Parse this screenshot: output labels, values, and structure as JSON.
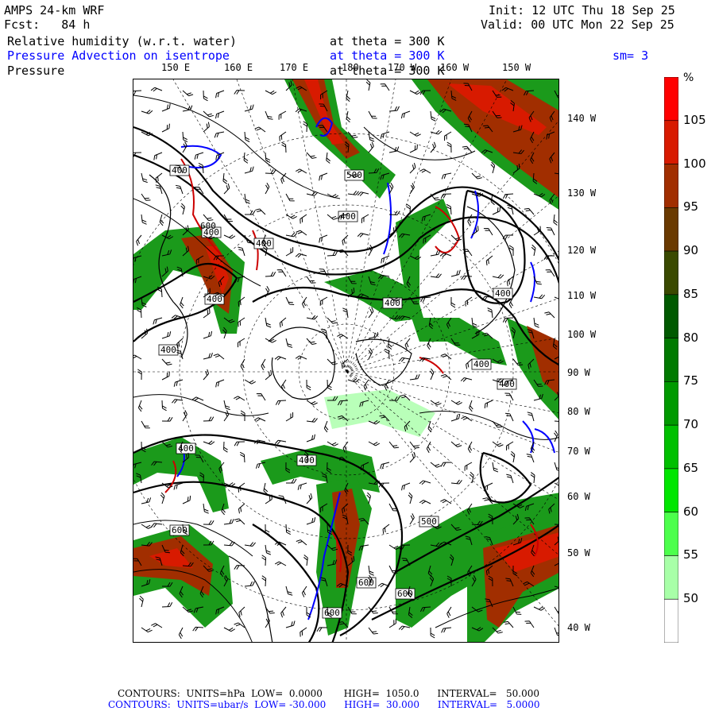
{
  "header": {
    "model": "AMPS 24-km WRF",
    "forecast": "Fcst:   84 h",
    "init": "Init: 12 UTC Thu 18 Sep 25",
    "valid": "Valid: 00 UTC Mon 22 Sep 25"
  },
  "fields": [
    {
      "name": "Relative humidity (w.r.t. water)",
      "level": "at theta = 300 K",
      "color": "#000000"
    },
    {
      "name": "Pressure Advection on isentrope",
      "level": "at theta = 300 K",
      "extra": "sm= 3",
      "color": "#0000ff"
    },
    {
      "name": "Pressure",
      "level": "at theta = 300 K",
      "color": "#000000"
    }
  ],
  "longitude_labels_top": [
    "150 E",
    "160 E",
    "170 E",
    "180",
    "170 W",
    "160 W",
    "150 W"
  ],
  "longitude_labels_right": [
    "140 W",
    "130 W",
    "120 W",
    "110 W",
    "100 W",
    "90 W",
    "80 W",
    "70 W",
    "60 W",
    "50 W",
    "40 W"
  ],
  "colorbar": {
    "unit": "%",
    "labels": [
      "105",
      "100",
      "95",
      "90",
      "85",
      "80",
      "75",
      "70",
      "65",
      "60",
      "55",
      "50"
    ],
    "colors": [
      "#ff0000",
      "#d81a00",
      "#a12e00",
      "#6a3a00",
      "#3a4a00",
      "#005a00",
      "#007a00",
      "#009a00",
      "#00c000",
      "#00e600",
      "#4cff4c",
      "#a8ffa8",
      "#ffffff"
    ]
  },
  "contour_labels": [
    "400",
    "400",
    "400",
    "400",
    "400",
    "400",
    "400",
    "400",
    "400",
    "400",
    "400",
    "400",
    "500",
    "500",
    "600",
    "600",
    "600",
    "600",
    "600"
  ],
  "footer": {
    "line1": "CONTOURS:  UNITS=hPa  LOW=  0.0000       HIGH=  1050.0      INTERVAL=   50.000",
    "line2": "CONTOURS:  UNITS=ubar/s  LOW= -30.000      HIGH=  30.000      INTERVAL=   5.0000"
  }
}
